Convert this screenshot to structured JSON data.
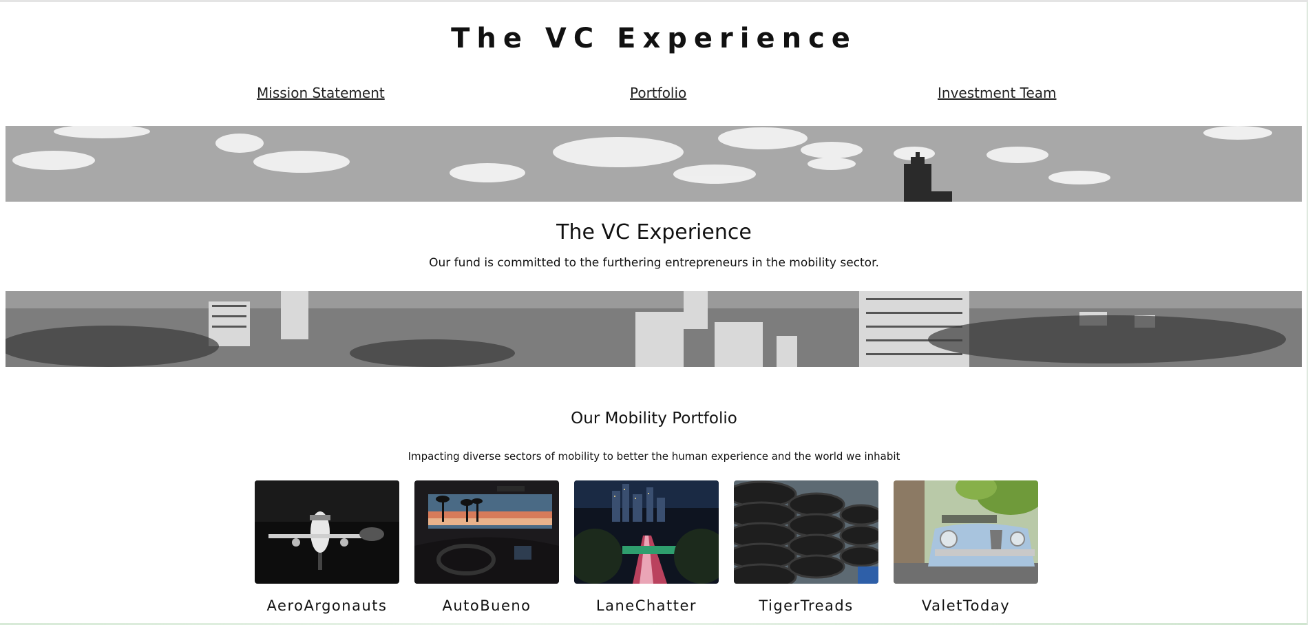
{
  "site": {
    "title": "The VC Experience"
  },
  "nav": {
    "items": [
      {
        "label": "Mission Statement"
      },
      {
        "label": "Portfolio"
      },
      {
        "label": "Investment Team"
      }
    ]
  },
  "hero": {
    "title": "The VC Experience",
    "subtitle": "Our fund is committed to the furthering entrepreneurs in the mobility sector."
  },
  "portfolio": {
    "title": "Our Mobility Portfolio",
    "subtitle": "Impacting diverse sectors of mobility to better the human experience and the world we inhabit",
    "companies": [
      {
        "name": "AeroArgonauts",
        "image": "private-jet-photo"
      },
      {
        "name": "AutoBueno",
        "image": "car-interior-sunset-photo"
      },
      {
        "name": "LaneChatter",
        "image": "city-highway-night-photo"
      },
      {
        "name": "TigerTreads",
        "image": "stacked-tires-photo"
      },
      {
        "name": "ValetToday",
        "image": "vintage-convertible-photo"
      }
    ]
  },
  "colors": {
    "text": "#111111",
    "background": "#ffffff"
  }
}
